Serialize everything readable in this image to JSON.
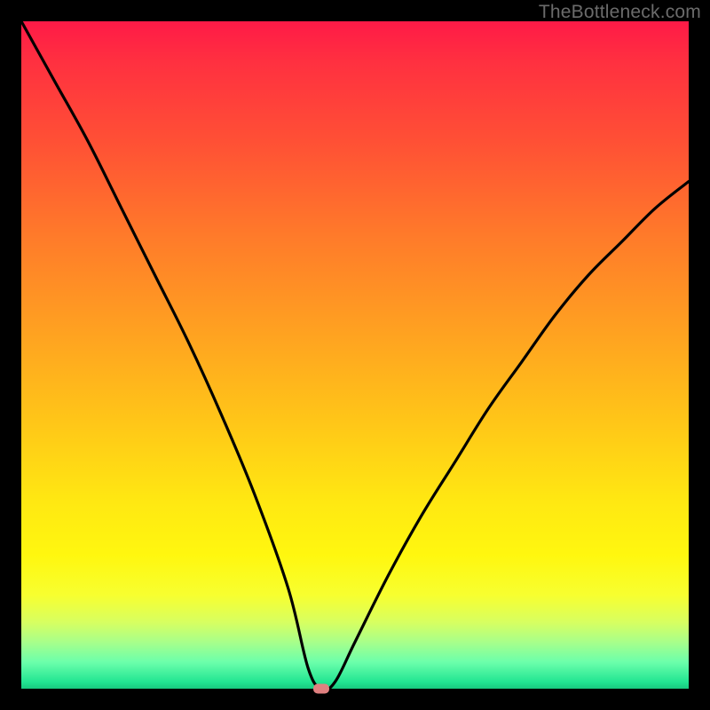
{
  "watermark": "TheBottleneck.com",
  "colors": {
    "frame_bg": "#000000",
    "gradient_top": "#ff1a47",
    "gradient_bottom": "#18c97f",
    "curve": "#000000",
    "marker": "#e08080"
  },
  "chart_data": {
    "type": "line",
    "title": "",
    "xlabel": "",
    "ylabel": "",
    "xlim": [
      0,
      100
    ],
    "ylim": [
      0,
      100
    ],
    "grid": false,
    "series": [
      {
        "name": "bottleneck-curve",
        "x": [
          0,
          5,
          10,
          15,
          20,
          25,
          30,
          35,
          40,
          43,
          45,
          47,
          50,
          55,
          60,
          65,
          70,
          75,
          80,
          85,
          90,
          95,
          100
        ],
        "values": [
          100,
          91,
          82,
          72,
          62,
          52,
          41,
          29,
          15,
          3,
          0,
          1,
          7,
          17,
          26,
          34,
          42,
          49,
          56,
          62,
          67,
          72,
          76
        ]
      }
    ],
    "marker": {
      "x": 45,
      "y": 0
    },
    "annotations": []
  }
}
